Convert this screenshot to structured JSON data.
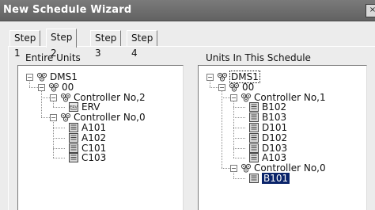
{
  "window": {
    "title": "New Schedule Wizard",
    "close": "×"
  },
  "tabs": [
    "Step 1",
    "Step 2",
    "Step 3",
    "Step 4"
  ],
  "left": {
    "label": "Entire Units",
    "root": "DMS1",
    "group": "00",
    "controllers": [
      {
        "label": "Controller No,2",
        "units": [
          "ERV"
        ]
      },
      {
        "label": "Controller No,0",
        "units": [
          "A101",
          "A102",
          "C101",
          "C103"
        ]
      }
    ]
  },
  "right": {
    "label": "Units In This Schedule",
    "root": "DMS1",
    "group": "00",
    "controllers": [
      {
        "label": "Controller No,1",
        "units": [
          "B102",
          "B103",
          "D101",
          "D102",
          "D103",
          "A103"
        ]
      },
      {
        "label": "Controller No,0",
        "units": [
          "B101"
        ]
      }
    ]
  },
  "colors": {
    "selection": "#0a246a",
    "titlebar": "#6e6e6e"
  }
}
